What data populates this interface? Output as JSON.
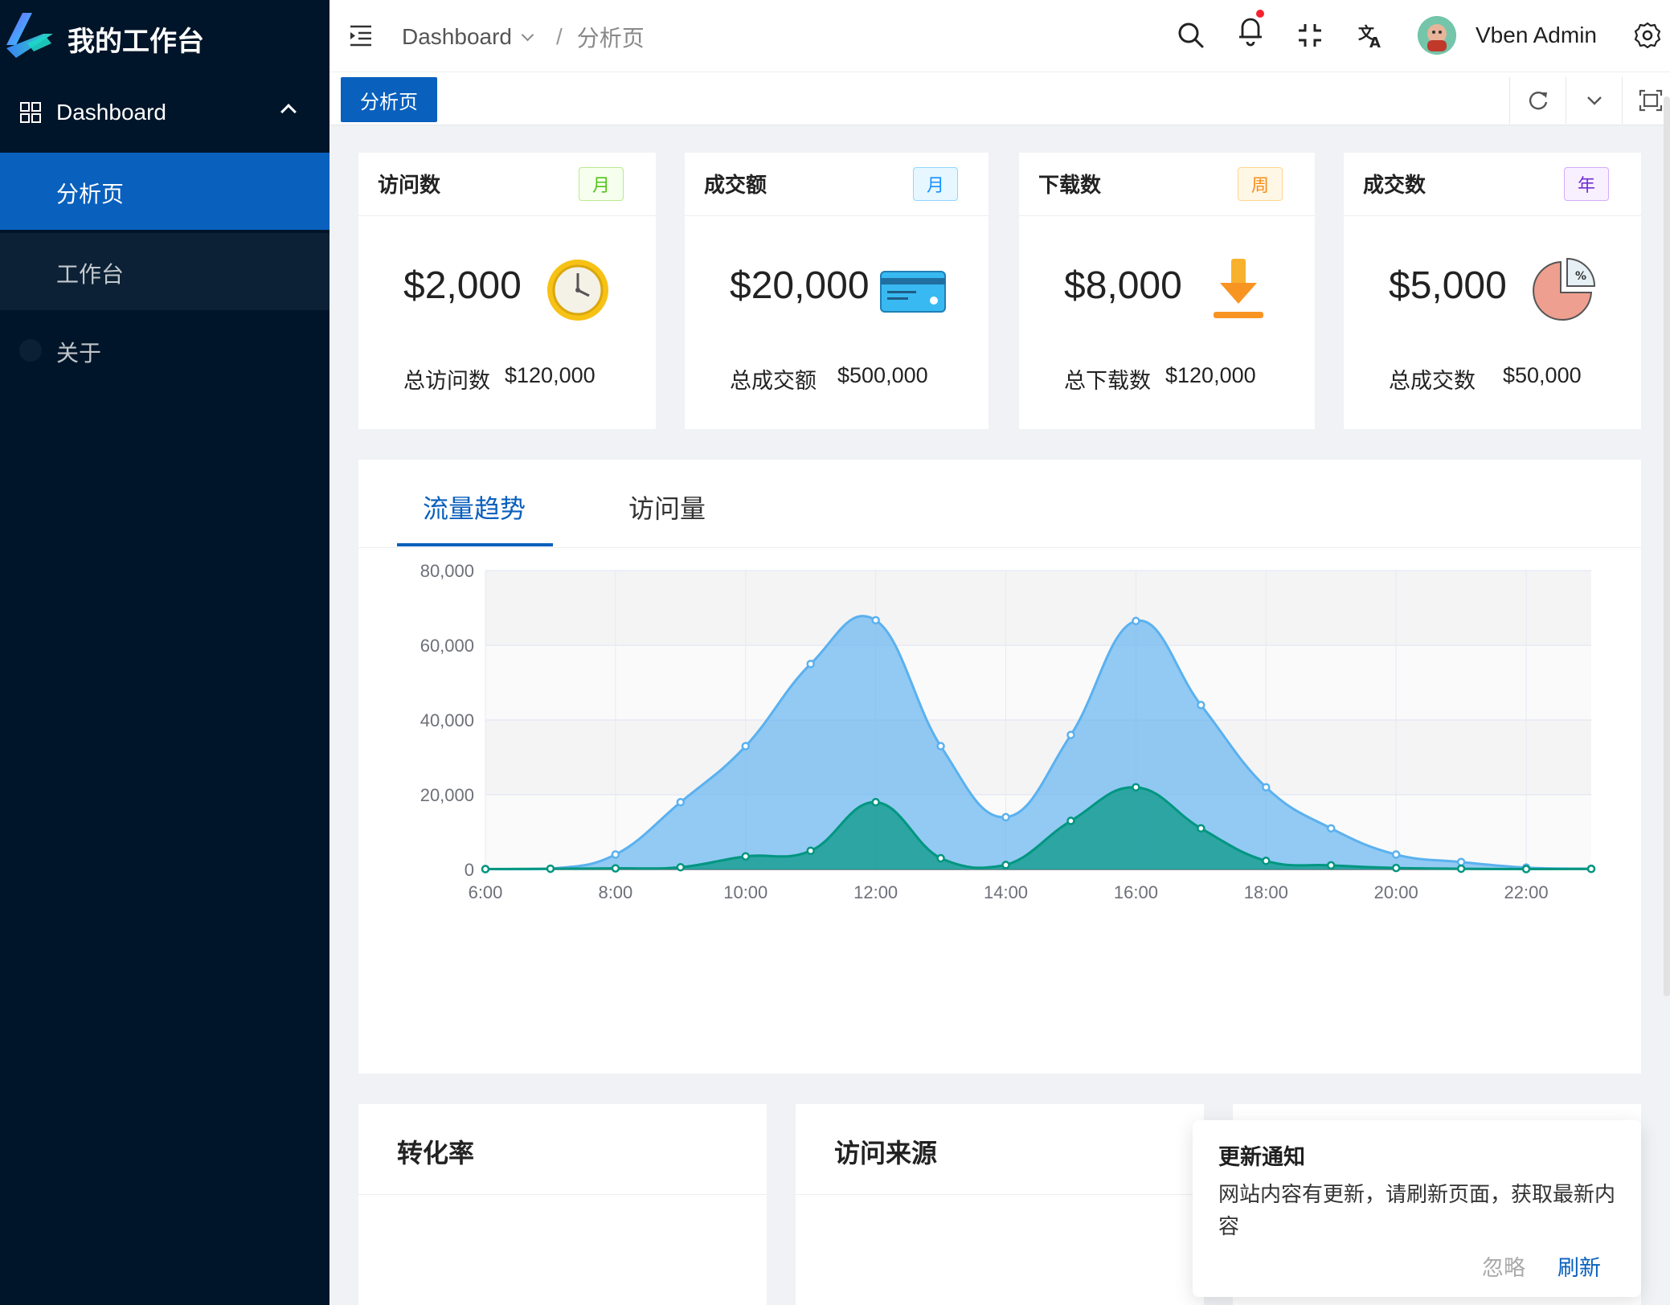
{
  "sidebar": {
    "app_title": "我的工作台",
    "menu_group": "Dashboard",
    "items": [
      {
        "label": "分析页"
      },
      {
        "label": "工作台"
      },
      {
        "label": "关于"
      }
    ]
  },
  "header": {
    "breadcrumb": [
      "Dashboard",
      "/",
      "分析页"
    ],
    "user_name": "Vben Admin",
    "icons": [
      "menu-fold-icon",
      "search-icon",
      "bell-icon",
      "fullscreen-icon",
      "translate-icon",
      "settings-icon"
    ]
  },
  "tabbar": {
    "active_tab": "分析页",
    "icons": [
      "refresh-icon",
      "chevron-down-icon",
      "fold-icon"
    ]
  },
  "stats": [
    {
      "title": "访问数",
      "tag": "月",
      "tag_color": "#52c41a",
      "value": "$2,000",
      "foot_label": "总访问数",
      "foot_value": "$120,000",
      "icon": "clock-icon"
    },
    {
      "title": "成交额",
      "tag": "月",
      "tag_color": "#1890ff",
      "value": "$20,000",
      "foot_label": "总成交额",
      "foot_value": "$500,000",
      "icon": "credit-card-icon"
    },
    {
      "title": "下载数",
      "tag": "周",
      "tag_color": "#fa8c16",
      "value": "$8,000",
      "foot_label": "总下载数",
      "foot_value": "$120,000",
      "icon": "download-icon"
    },
    {
      "title": "成交数",
      "tag": "年",
      "tag_color": "#722ed1",
      "value": "$5,000",
      "foot_label": "总成交数",
      "foot_value": "$50,000",
      "icon": "pie-chart-icon"
    }
  ],
  "trend": {
    "tabs": [
      "流量趋势",
      "访问量"
    ]
  },
  "chart_data": {
    "type": "area",
    "x": [
      "6:00",
      "7:00",
      "8:00",
      "9:00",
      "10:00",
      "11:00",
      "12:00",
      "13:00",
      "14:00",
      "15:00",
      "16:00",
      "17:00",
      "18:00",
      "19:00",
      "20:00",
      "21:00",
      "22:00",
      "23:00"
    ],
    "x_tick_labels": [
      "6:00",
      "8:00",
      "10:00",
      "12:00",
      "14:00",
      "16:00",
      "18:00",
      "20:00",
      "22:00"
    ],
    "y_tick_labels": [
      "0",
      "20,000",
      "40,000",
      "60,000",
      "80,000"
    ],
    "ylim": [
      0,
      80000
    ],
    "grid": true,
    "series": [
      {
        "values": [
          100,
          200,
          4000,
          18000,
          33000,
          55000,
          66700,
          33000,
          14000,
          36000,
          66500,
          44000,
          22000,
          11000,
          4000,
          2000,
          500,
          200
        ],
        "color": "#5ab1ef"
      },
      {
        "values": [
          100,
          200,
          300,
          600,
          3500,
          5000,
          18000,
          3000,
          1200,
          13000,
          22000,
          11000,
          2300,
          1100,
          400,
          200,
          100,
          150
        ],
        "color": "#019680"
      }
    ]
  },
  "bottom_cards": [
    {
      "title": "转化率"
    },
    {
      "title": "访问来源"
    },
    {
      "title": ""
    }
  ],
  "notification": {
    "title": "更新通知",
    "desc": "网站内容有更新，请刷新页面，获取最新内容",
    "ignore": "忽略",
    "refresh": "刷新"
  }
}
